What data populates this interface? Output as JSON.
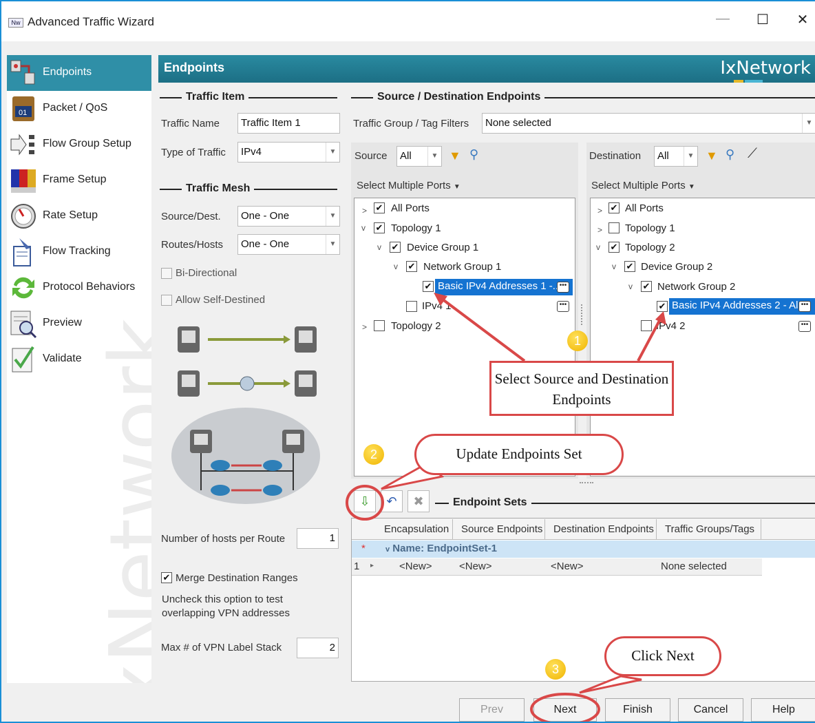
{
  "window": {
    "title": "Advanced Traffic Wizard",
    "app_icon_text": "Nw",
    "minimize": "—",
    "maximize": "☐",
    "close": "✕"
  },
  "sidebar": {
    "items": [
      {
        "label": "Endpoints",
        "icon": "endpoints-icon"
      },
      {
        "label": "Packet / QoS",
        "icon": "packet-qos-icon"
      },
      {
        "label": "Flow Group Setup",
        "icon": "flow-group-icon"
      },
      {
        "label": "Frame Setup",
        "icon": "frame-setup-icon"
      },
      {
        "label": "Rate Setup",
        "icon": "gauge-icon"
      },
      {
        "label": "Flow Tracking",
        "icon": "flow-tracking-icon"
      },
      {
        "label": "Protocol Behaviors",
        "icon": "protocol-arrows-icon"
      },
      {
        "label": "Preview",
        "icon": "preview-icon"
      },
      {
        "label": "Validate",
        "icon": "validate-icon"
      }
    ],
    "watermark": "IxNetwork"
  },
  "header": {
    "title": "Endpoints",
    "brand": "IxNetwork"
  },
  "traffic_item": {
    "section": "Traffic Item",
    "name_label": "Traffic Name",
    "name_value": "Traffic Item 1",
    "type_label": "Type of Traffic",
    "type_value": "IPv4"
  },
  "traffic_mesh": {
    "section": "Traffic Mesh",
    "srcdst_label": "Source/Dest.",
    "srcdst_value": "One - One",
    "routes_label": "Routes/Hosts",
    "routes_value": "One - One",
    "bidirectional": "Bi-Directional",
    "self_destined": "Allow Self-Destined",
    "hosts_label": "Number of hosts per Route",
    "hosts_value": "1",
    "merge_label": "Merge Destination Ranges",
    "merge_help": "Uncheck this option to test overlapping VPN addresses",
    "vpn_label": "Max # of VPN Label Stack",
    "vpn_value": "2"
  },
  "endpoints": {
    "section": "Source / Destination Endpoints",
    "filter_label": "Traffic Group / Tag Filters",
    "filter_value": "None selected",
    "source": {
      "label": "Source",
      "filter": "All",
      "multi": "Select Multiple Ports",
      "nodes": [
        "All Ports",
        "Topology 1",
        "Device Group 1",
        "Network Group 1",
        "Basic IPv4 Addresses 1 -...",
        "IPv4 1",
        "Topology 2"
      ]
    },
    "destination": {
      "label": "Destination",
      "filter": "All",
      "multi": "Select Multiple Ports",
      "nodes": [
        "All Ports",
        "Topology 1",
        "Topology 2",
        "Device Group 2",
        "Network Group 2",
        "Basic IPv4 Addresses 2 - Al...",
        "IPv4 2"
      ]
    }
  },
  "endpoint_sets": {
    "section": "Endpoint Sets",
    "columns": [
      "Encapsulation",
      "Source Endpoints",
      "Destination Endpoints",
      "Traffic Groups/Tags"
    ],
    "group_row": "Name: EndpointSet-1",
    "row": {
      "index": "1",
      "encapsulation": "<New>",
      "source": "<New>",
      "destination": "<New>",
      "tags": "None selected"
    }
  },
  "callouts": {
    "c1": "Select Source and Destination Endpoints",
    "c2": "Update Endpoints Set",
    "c3": "Click Next",
    "b1": "1",
    "b2": "2",
    "b3": "3"
  },
  "buttons": {
    "prev": "Prev",
    "next": "Next",
    "finish": "Finish",
    "cancel": "Cancel",
    "help": "Help"
  },
  "colors": {
    "header": "#1c6f85",
    "selection": "#1573d1",
    "callout": "#d94848",
    "badge": "#f0b400"
  }
}
